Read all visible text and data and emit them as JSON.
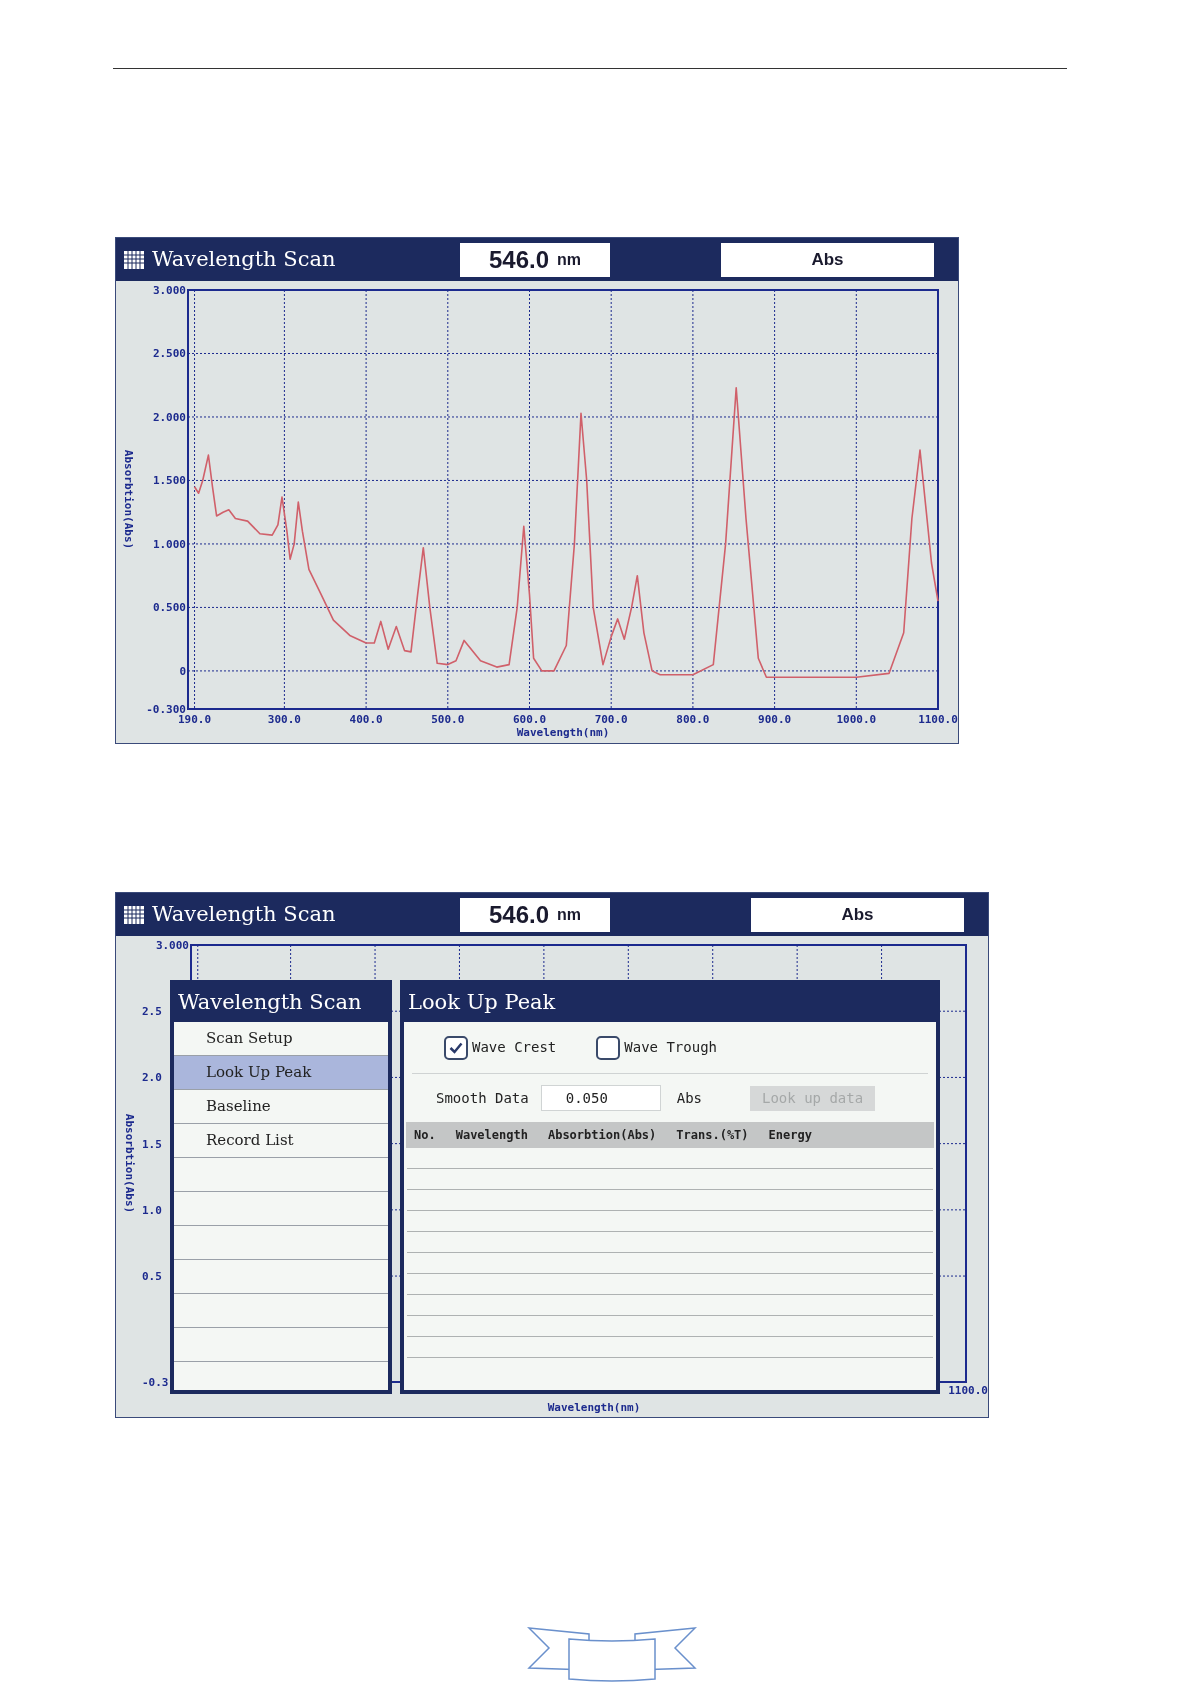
{
  "screens": [
    {
      "kind": "plot",
      "title": "Wavelength Scan",
      "wavelength": "546.0",
      "unit": "nm",
      "mode": "Abs",
      "chart_data": {
        "type": "line",
        "grid": true,
        "xlabel": "Wavelength(nm)",
        "ylabel": "Absorbtion(Abs)",
        "xlim": [
          182,
          1100
        ],
        "ylim": [
          -0.3,
          3.0
        ],
        "xticks": [
          {
            "value": 190,
            "label": "190.0"
          },
          {
            "value": 300,
            "label": "300.0"
          },
          {
            "value": 400,
            "label": "400.0"
          },
          {
            "value": 500,
            "label": "500.0"
          },
          {
            "value": 600,
            "label": "600.0"
          },
          {
            "value": 700,
            "label": "700.0"
          },
          {
            "value": 800,
            "label": "800.0"
          },
          {
            "value": 900,
            "label": "900.0"
          },
          {
            "value": 1000,
            "label": "1000.0"
          },
          {
            "value": 1100,
            "label": "1100.0"
          }
        ],
        "yticks": [
          {
            "value": -0.3,
            "label": "-0.300"
          },
          {
            "value": 0,
            "label": "0"
          },
          {
            "value": 0.5,
            "label": "0.500"
          },
          {
            "value": 1.0,
            "label": "1.000"
          },
          {
            "value": 1.5,
            "label": "1.500"
          },
          {
            "value": 2.0,
            "label": "2.000"
          },
          {
            "value": 2.5,
            "label": "2.500"
          },
          {
            "value": 3.0,
            "label": "3.000"
          }
        ],
        "x": [
          190,
          195,
          200,
          207,
          212,
          217,
          225,
          232,
          240,
          255,
          270,
          285,
          292,
          297,
          303,
          307,
          312,
          317,
          322,
          330,
          345,
          360,
          380,
          400,
          410,
          418,
          427,
          437,
          447,
          455,
          463,
          470,
          478,
          487,
          500,
          510,
          520,
          540,
          560,
          575,
          585,
          593,
          600,
          605,
          615,
          630,
          645,
          655,
          663,
          670,
          678,
          690,
          700,
          708,
          716,
          725,
          732,
          740,
          750,
          760,
          800,
          825,
          840,
          853,
          865,
          880,
          890,
          1000,
          1040,
          1058,
          1068,
          1078,
          1085,
          1092,
          1100
        ],
        "series": [
          {
            "color": "#d0606a",
            "values": [
              1.45,
              1.4,
              1.5,
              1.7,
              1.45,
              1.22,
              1.25,
              1.27,
              1.2,
              1.18,
              1.08,
              1.07,
              1.15,
              1.37,
              1.1,
              0.88,
              1.0,
              1.33,
              1.1,
              0.8,
              0.6,
              0.4,
              0.28,
              0.22,
              0.22,
              0.39,
              0.17,
              0.35,
              0.16,
              0.15,
              0.6,
              0.97,
              0.5,
              0.06,
              0.05,
              0.08,
              0.24,
              0.08,
              0.03,
              0.05,
              0.5,
              1.14,
              0.6,
              0.1,
              0.0,
              0.0,
              0.2,
              1.0,
              2.03,
              1.5,
              0.5,
              0.05,
              0.27,
              0.41,
              0.25,
              0.5,
              0.75,
              0.3,
              0.0,
              -0.03,
              -0.03,
              0.05,
              1.0,
              2.23,
              1.2,
              0.1,
              -0.05,
              -0.05,
              -0.02,
              0.3,
              1.2,
              1.74,
              1.3,
              0.85,
              0.55
            ]
          }
        ]
      }
    },
    {
      "kind": "menu",
      "title": "Wavelength Scan",
      "wavelength": "546.0",
      "unit": "nm",
      "mode": "Abs",
      "background_plot": {
        "xlabel": "Wavelength(nm)",
        "ylabel": "Absorbtion(Abs)",
        "end_label": "1100.0",
        "ytick_labels": [
          "3.000",
          "2.5",
          "2.0",
          "1.5",
          "1.0",
          "0.5",
          "-0.3"
        ]
      },
      "menu": {
        "title": "Wavelength Scan",
        "items": [
          {
            "label": "Scan Setup",
            "selected": false
          },
          {
            "label": "Look Up Peak",
            "selected": true
          },
          {
            "label": "Baseline",
            "selected": false
          },
          {
            "label": "Record List",
            "selected": false
          }
        ]
      },
      "dialog": {
        "title": "Look Up Peak",
        "options": [
          {
            "label": "Wave Crest",
            "checked": true
          },
          {
            "label": "Wave Trough",
            "checked": false
          }
        ],
        "smooth": {
          "label": "Smooth Data",
          "value": "0.050",
          "unit": "Abs"
        },
        "button": {
          "label": "Look up data",
          "disabled": true
        },
        "columns": [
          "No.",
          "Wavelength",
          "Absorbtion(Abs)",
          "Trans.(%T)",
          "Energy"
        ]
      }
    }
  ]
}
